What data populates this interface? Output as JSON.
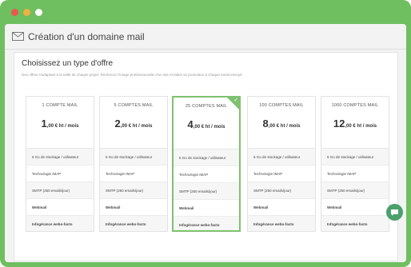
{
  "window": {
    "dot_colors": [
      "#e8594b",
      "#f0b142",
      "#ffffff"
    ]
  },
  "header": {
    "title": "Création d'un domaine mail",
    "icon": "mail-icon"
  },
  "section": {
    "title": "Choisissez un type d'offre",
    "description": "Des offres s'adaptant à la taille de chaque projet. Renforcez l'image professionnelle d'un site et faites sa promotion à chaque email envoyé."
  },
  "plans": [
    {
      "name": "1 COMPTE MAIL",
      "price_int": "1",
      "price_rest": ",00 € ht / mois",
      "selected": false
    },
    {
      "name": "5 COMPTES MAIL",
      "price_int": "2",
      "price_rest": ",00 € ht / mois",
      "selected": false
    },
    {
      "name": "25 COMPTES MAIL",
      "price_int": "4",
      "price_rest": ",00 € ht / mois",
      "selected": true
    },
    {
      "name": "100 COMPTES MAIL",
      "price_int": "8",
      "price_rest": ",00 € ht / mois",
      "selected": false
    },
    {
      "name": "1000 COMPTES MAIL",
      "price_int": "12",
      "price_rest": ",00 € ht / mois",
      "selected": false
    }
  ],
  "features": [
    "5 Go de stockage / utilisateur",
    "Technologie IMAP",
    "SMTP (250 emails/jour)",
    "Webmail",
    "Infogérance webo-facto"
  ],
  "chat": {
    "icon": "chat-icon"
  },
  "colors": {
    "accent": "#7ec16e",
    "frame": "#6fbe60",
    "chat": "#4ca06a"
  }
}
